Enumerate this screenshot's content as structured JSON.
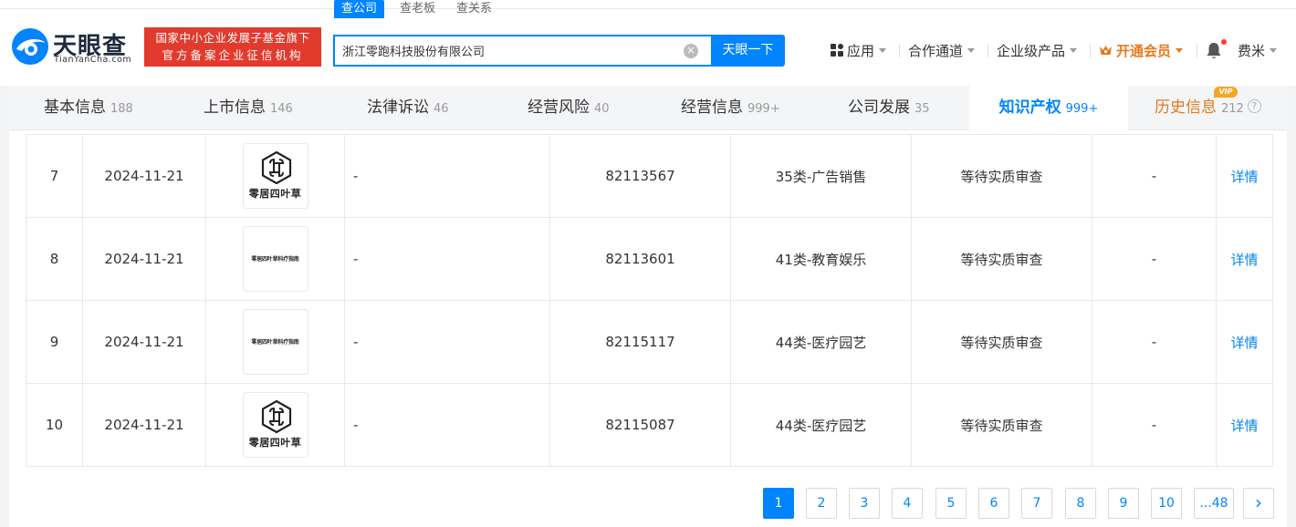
{
  "header": {
    "logo_cn": "天眼查",
    "logo_en": "TianYanCha.com",
    "badge_line1": "国家中小企业发展子基金旗下",
    "badge_line2": "官方备案企业征信机构",
    "search_tabs": [
      "查公司",
      "查老板",
      "查关系"
    ],
    "search_value": "浙江零跑科技股份有限公司",
    "search_button": "天眼一下",
    "nav": {
      "apps": "应用",
      "cooperation": "合作通道",
      "enterprise": "企业级产品",
      "vip": "开通会员",
      "user": "费米"
    }
  },
  "tabs": [
    {
      "label": "基本信息",
      "count": "188"
    },
    {
      "label": "上市信息",
      "count": "146"
    },
    {
      "label": "法律诉讼",
      "count": "46"
    },
    {
      "label": "经营风险",
      "count": "40"
    },
    {
      "label": "经营信息",
      "count": "999+"
    },
    {
      "label": "公司发展",
      "count": "35"
    },
    {
      "label": "知识产权",
      "count": "999+"
    },
    {
      "label": "历史信息",
      "count": "212"
    }
  ],
  "vip_tag": "VIP",
  "rows": [
    {
      "index": "7",
      "date": "2024-11-21",
      "mark_text": "零居四叶草",
      "mark_type": "logo",
      "name": "-",
      "reg_no": "82113567",
      "category": "35类-广告销售",
      "status": "等待实质审查",
      "extra": "-",
      "detail": "详情"
    },
    {
      "index": "8",
      "date": "2024-11-21",
      "mark_text": "零居四叶草科疗指南",
      "mark_type": "text",
      "name": "-",
      "reg_no": "82113601",
      "category": "41类-教育娱乐",
      "status": "等待实质审查",
      "extra": "-",
      "detail": "详情"
    },
    {
      "index": "9",
      "date": "2024-11-21",
      "mark_text": "零居四叶草科疗指南",
      "mark_type": "text",
      "name": "-",
      "reg_no": "82115117",
      "category": "44类-医疗园艺",
      "status": "等待实质审查",
      "extra": "-",
      "detail": "详情"
    },
    {
      "index": "10",
      "date": "2024-11-21",
      "mark_text": "零居四叶草",
      "mark_type": "logo",
      "name": "-",
      "reg_no": "82115087",
      "category": "44类-医疗园艺",
      "status": "等待实质审查",
      "extra": "-",
      "detail": "详情"
    }
  ],
  "pagination": {
    "pages": [
      "1",
      "2",
      "3",
      "4",
      "5",
      "6",
      "7",
      "8",
      "9",
      "10",
      "...48"
    ],
    "current": "1",
    "next": "›"
  },
  "colors": {
    "accent": "#0084ff",
    "badge_red": "#e23b2e",
    "vip_orange": "#e6791b"
  }
}
